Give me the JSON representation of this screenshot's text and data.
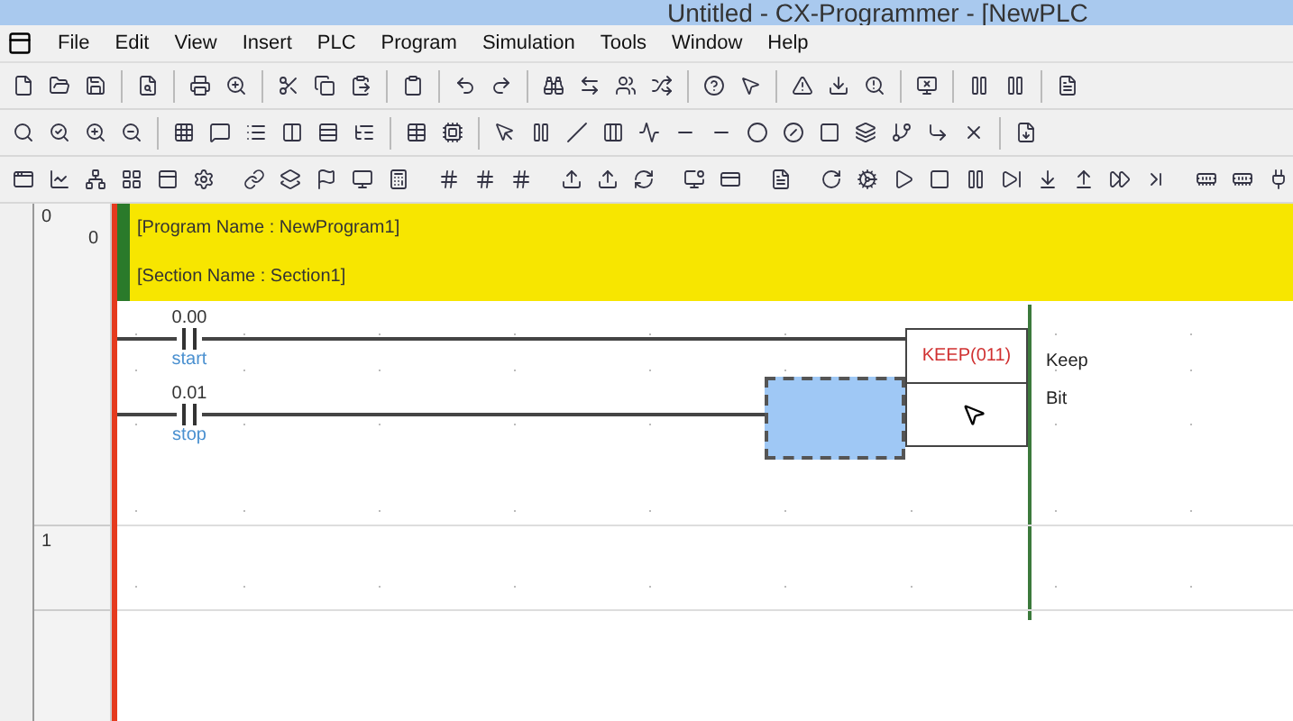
{
  "window": {
    "title": "Untitled - CX-Programmer - [NewPLC"
  },
  "menu": [
    "File",
    "Edit",
    "View",
    "Insert",
    "PLC",
    "Program",
    "Simulation",
    "Tools",
    "Window",
    "Help"
  ],
  "ladder": {
    "rungs": [
      {
        "number": "0",
        "step": "0",
        "program_name": "[Program Name : NewProgram1]",
        "section_name": "[Section Name : Section1]",
        "contacts": [
          {
            "address": "0.00",
            "comment": "start"
          },
          {
            "address": "0.01",
            "comment": "stop"
          }
        ],
        "instruction": {
          "name": "KEEP(011)"
        },
        "comments": [
          "Keep",
          "Bit"
        ],
        "selection": true
      },
      {
        "number": "1"
      }
    ]
  }
}
